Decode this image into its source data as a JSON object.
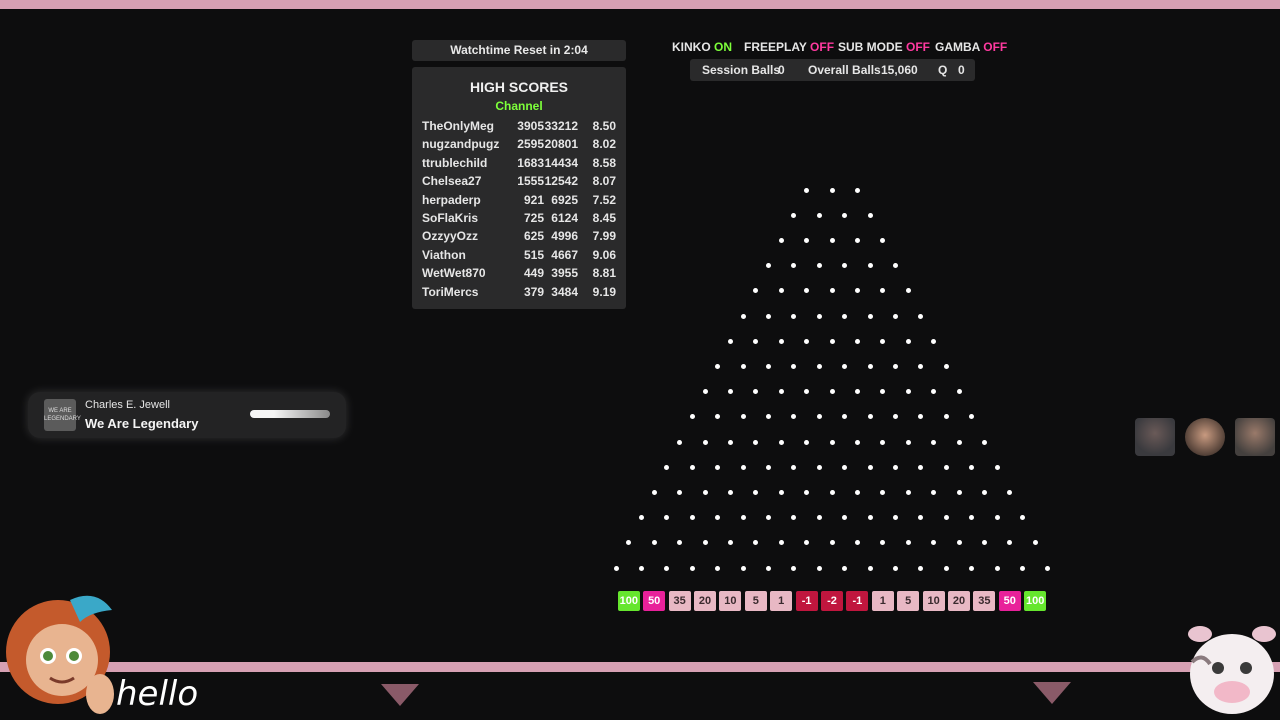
{
  "watchtime": {
    "label": "Watchtime Reset in 2:04"
  },
  "high_scores": {
    "title": "HIGH SCORES",
    "subtitle": "Channel",
    "rows": [
      {
        "name": "TheOnlyMeg",
        "a": "3905",
        "b": "33212",
        "c": "8.50"
      },
      {
        "name": "nugzandpugz",
        "a": "2595",
        "b": "20801",
        "c": "8.02"
      },
      {
        "name": "ttrublechild",
        "a": "1683",
        "b": "14434",
        "c": "8.58"
      },
      {
        "name": "Chelsea27",
        "a": "1555",
        "b": "12542",
        "c": "8.07"
      },
      {
        "name": "herpaderp",
        "a": "921",
        "b": "6925",
        "c": "7.52"
      },
      {
        "name": "SoFlaKris",
        "a": "725",
        "b": "6124",
        "c": "8.45"
      },
      {
        "name": "OzzyyOzz",
        "a": "625",
        "b": "4996",
        "c": "7.99"
      },
      {
        "name": "Viathon",
        "a": "515",
        "b": "4667",
        "c": "9.06"
      },
      {
        "name": "WetWet870",
        "a": "449",
        "b": "3955",
        "c": "8.81"
      },
      {
        "name": "ToriMercs",
        "a": "379",
        "b": "3484",
        "c": "9.19"
      }
    ]
  },
  "modes": {
    "kinko": {
      "label": "KINKO",
      "state": "ON"
    },
    "freeplay": {
      "label": "FREEPLAY",
      "state": "OFF"
    },
    "submode": {
      "label": "SUB MODE",
      "state": "OFF"
    },
    "gamba": {
      "label": "GAMBA",
      "state": "OFF"
    }
  },
  "counts": {
    "session_label": "Session Balls",
    "session_value": "0",
    "overall_label": "Overall Balls",
    "overall_value": "15,060",
    "q_label": "Q",
    "q_value": "0"
  },
  "plinko": {
    "rows": 16,
    "first_row_pegs": 3,
    "slots": [
      {
        "label": "100",
        "color": "#66e62e"
      },
      {
        "label": "50",
        "color": "#e8219a"
      },
      {
        "label": "35",
        "color": "#e8b8c4"
      },
      {
        "label": "20",
        "color": "#e8b8c4"
      },
      {
        "label": "10",
        "color": "#e8b8c4"
      },
      {
        "label": "5",
        "color": "#e8b8c4"
      },
      {
        "label": "1",
        "color": "#e8b8c4"
      },
      {
        "label": "-1",
        "color": "#c0163e"
      },
      {
        "label": "-2",
        "color": "#c0163e"
      },
      {
        "label": "-1",
        "color": "#c0163e"
      },
      {
        "label": "1",
        "color": "#e8b8c4"
      },
      {
        "label": "5",
        "color": "#e8b8c4"
      },
      {
        "label": "10",
        "color": "#e8b8c4"
      },
      {
        "label": "20",
        "color": "#e8b8c4"
      },
      {
        "label": "35",
        "color": "#e8b8c4"
      },
      {
        "label": "50",
        "color": "#e8219a"
      },
      {
        "label": "100",
        "color": "#66e62e"
      }
    ]
  },
  "now_playing": {
    "art_text": "WE ARE LEGENDARY",
    "artist": "Charles E. Jewell",
    "song": "We Are Legendary",
    "progress": 0.3
  },
  "overlay": {
    "hello": "hello"
  },
  "colors": {
    "accent_pink": "#d6a0b3",
    "on": "#7dff3a",
    "off": "#ff3aa0"
  }
}
